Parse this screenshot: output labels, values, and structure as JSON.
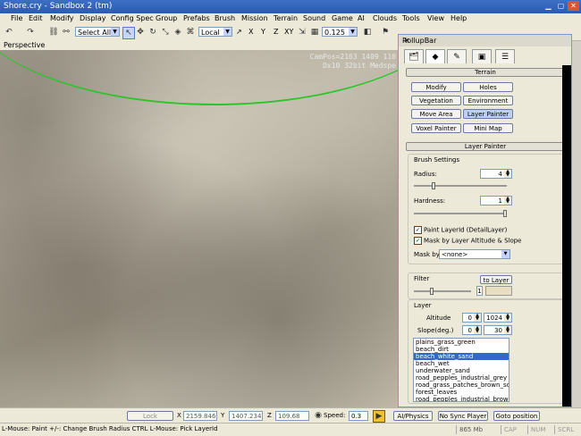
{
  "window": {
    "title": "Shore.cry - Sandbox 2 (tm)"
  },
  "menu": [
    "File",
    "Edit",
    "Modify",
    "Display",
    "Config Spec",
    "Group",
    "Prefabs",
    "Brush",
    "Mission",
    "Terrain",
    "Sound",
    "Game",
    "AI",
    "Clouds",
    "Tools",
    "View",
    "Help"
  ],
  "toolbar": {
    "select_mode": "Select All",
    "coord_system": "Local",
    "axes": [
      "X",
      "Y",
      "Z",
      "XY"
    ],
    "grid_value": "0.125"
  },
  "viewport": {
    "label": "Perspective",
    "overlay_lines": [
      "CamPos=2163 1409 110",
      "Dx10 32bit Medspe"
    ]
  },
  "rollup": {
    "title": "RollupBar",
    "terrain_header": "Terrain",
    "buttons": [
      "Modify",
      "Holes",
      "Vegetation",
      "Environment",
      "Move Area",
      "Layer Painter",
      "Voxel Painter",
      "Mini Map"
    ],
    "active_button": "Layer Painter",
    "layer_painter_header": "Layer Painter",
    "brush_settings": {
      "title": "Brush Settings",
      "radius_label": "Radius:",
      "radius_value": "4",
      "radius_fraction": 0.2,
      "hardness_label": "Hardness:",
      "hardness_value": "1",
      "hardness_fraction": 1.0,
      "paint_layer_label": "Paint LayerId (DetailLayer)",
      "mask_altitude_label": "Mask by Layer Altitude & Slope",
      "mask_by_label": "Mask by",
      "mask_by_value": "<none>"
    },
    "filter": {
      "title": "Filter",
      "to_layer_label": "to Layer",
      "value": "1",
      "fraction": 0.3
    },
    "layer": {
      "title": "Layer",
      "altitude_label": "Altitude",
      "altitude_min": "0",
      "altitude_max": "1024",
      "slope_label": "Slope(deg.)",
      "slope_min": "0",
      "slope_max": "30",
      "items": [
        "plains_grass_green",
        "beach_dirt",
        "beach_white_sand",
        "beach_wet",
        "underwater_sand",
        "road_pepples_industrial_grey",
        "road_grass_patches_brown_soil",
        "forest_leaves",
        "road_pepples_industrial_brown"
      ],
      "selected_index": 2
    }
  },
  "timebar": {
    "lock_selection": "Lock Selection",
    "x_label": "X",
    "x_value": "2159.846",
    "y_label": "Y",
    "y_value": "1407.234",
    "z_label": "Z",
    "z_value": "109.68",
    "speed_label": "Speed:",
    "speed_value": "0.3",
    "ai_physics": "AI/Physics",
    "no_sync": "No Sync Player",
    "goto": "Goto position"
  },
  "statusbar": {
    "hint": "L-Mouse: Paint   +/-: Change Brush Radius   CTRL L-Mouse: Pick LayerId",
    "memory": "865 Mb",
    "caps": "CAP",
    "num": "NUM",
    "scroll": "SCRL"
  },
  "colors": {
    "accent": "#3169c6",
    "selection_guide": "#29c629"
  }
}
